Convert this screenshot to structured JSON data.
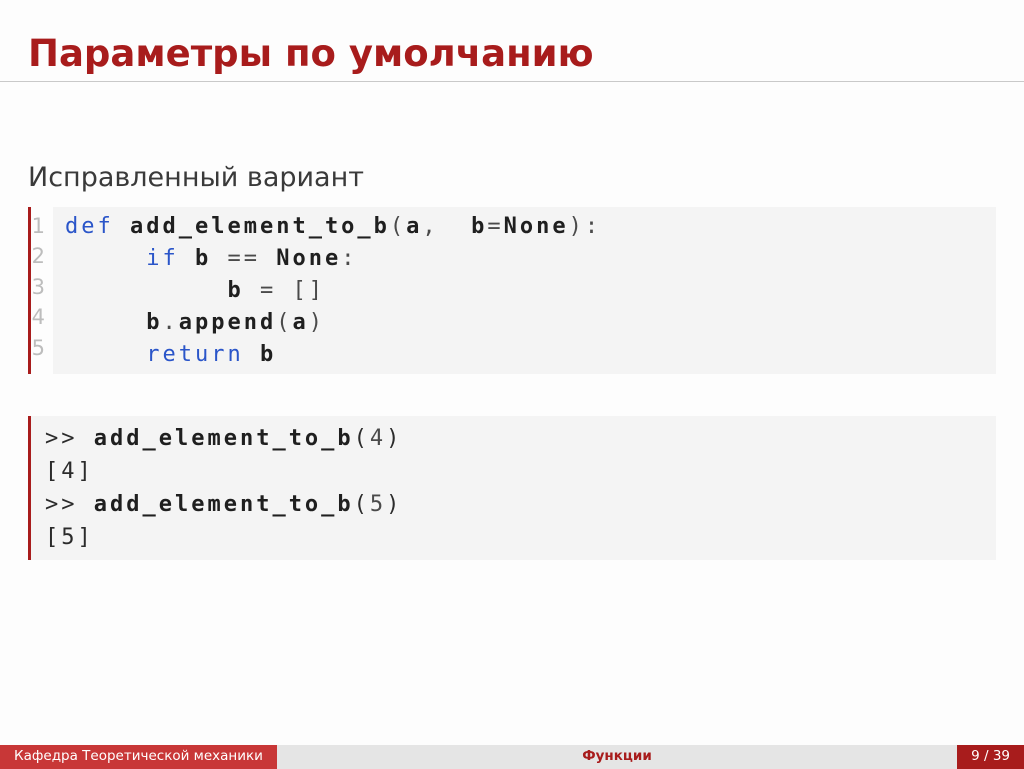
{
  "title": "Параметры по умолчанию",
  "subtitle": "Исправленный вариант",
  "code": {
    "lineNumbers": [
      "1",
      "2",
      "3",
      "4",
      "5"
    ],
    "l1": {
      "def": "def",
      "name": "add_element_to_b",
      "open": "(",
      "a": "a",
      "comma": ",",
      "b": "b",
      "eq": "=",
      "none": "None",
      "close": ")",
      "colon": ":"
    },
    "l2": {
      "indent": "     ",
      "if": "if",
      "b": "b",
      "eqeq": "==",
      "none": "None",
      "colon": ":"
    },
    "l3": {
      "indent": "          ",
      "b": "b",
      "eq": "=",
      "brackets": "[]"
    },
    "l4": {
      "indent": "     ",
      "b": "b",
      "dot": ".",
      "append": "append",
      "open": "(",
      "a": "a",
      "close": ")"
    },
    "l5": {
      "indent": "     ",
      "return": "return",
      "b": "b"
    }
  },
  "output": {
    "l1": {
      "prompt": ">> ",
      "fn": "add_element_to_b",
      "open": "(",
      "arg": "4",
      "close": ")"
    },
    "l2": "[4]",
    "l3": {
      "prompt": ">> ",
      "fn": "add_element_to_b",
      "open": "(",
      "arg": "5",
      "close": ")"
    },
    "l4": "[5]"
  },
  "footer": {
    "left": "Кафедра Теоретической механики",
    "mid": "Функции",
    "right": "9 / 39"
  }
}
